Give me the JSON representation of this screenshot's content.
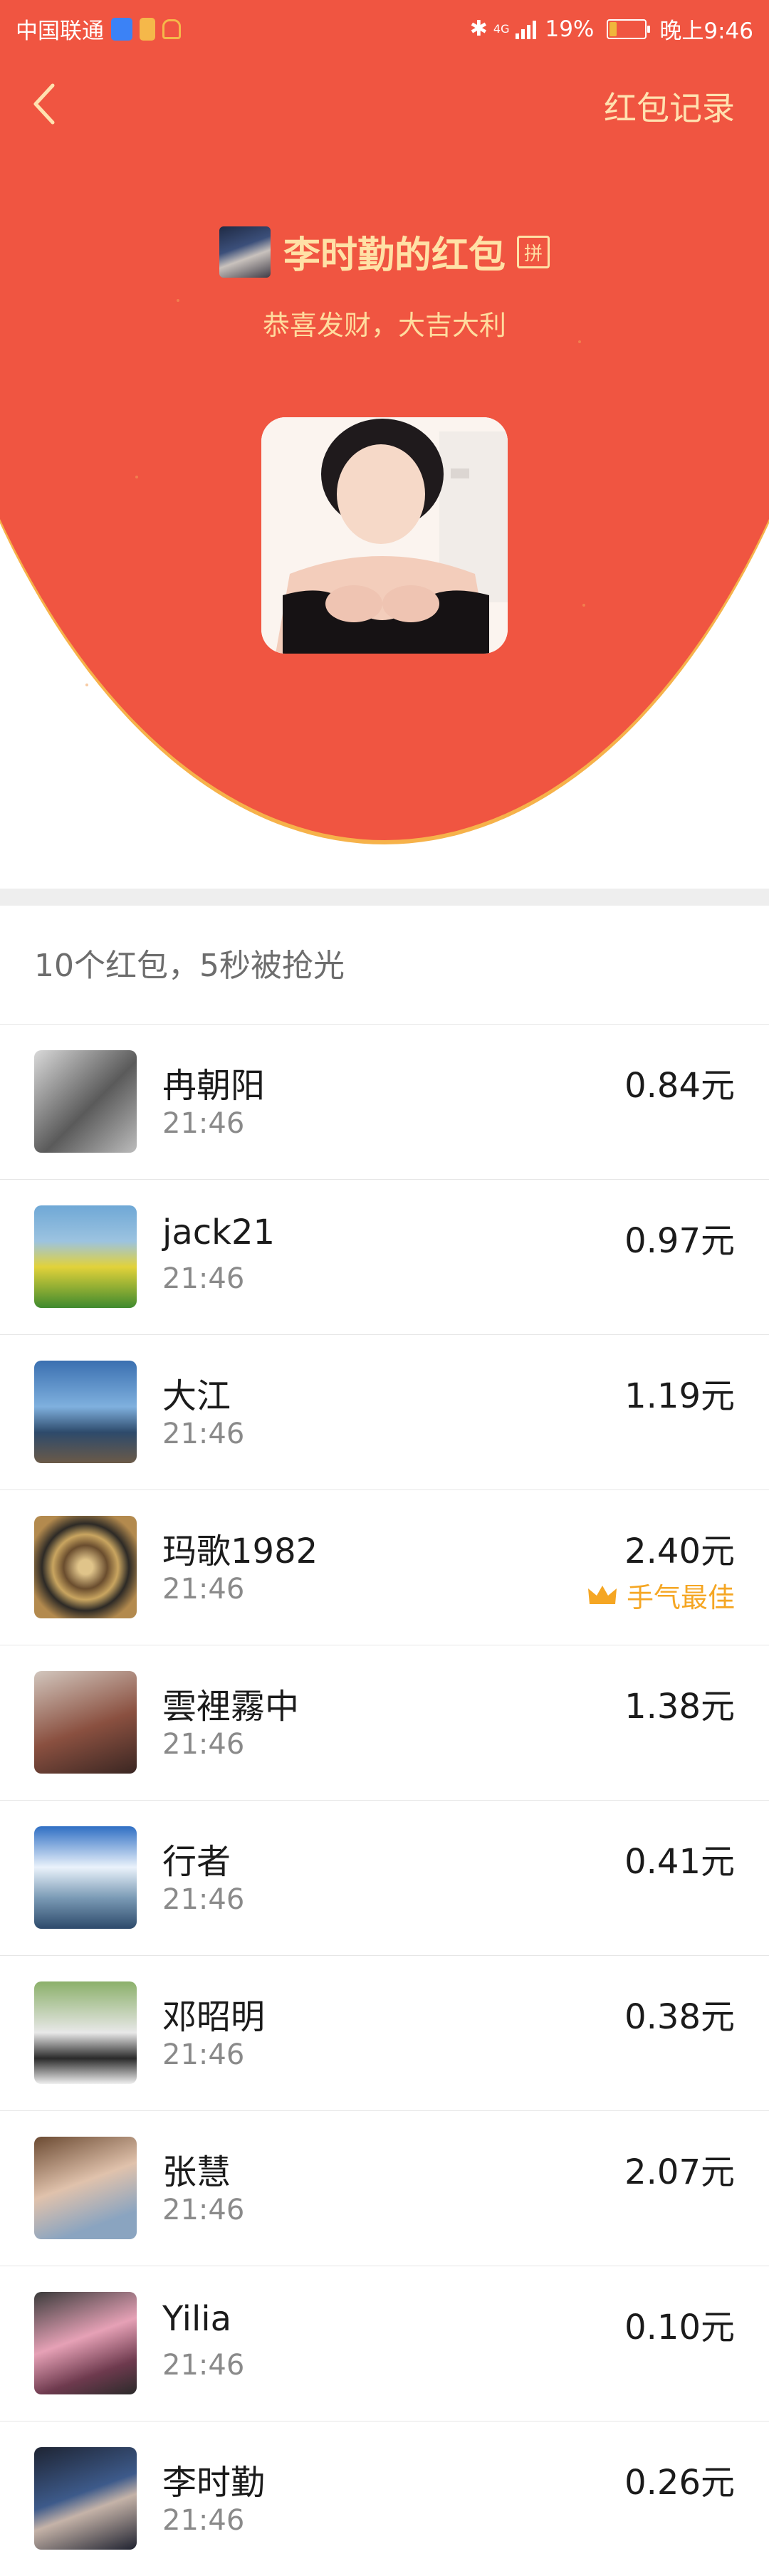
{
  "status_bar": {
    "carrier": "中国联通",
    "network": "4G",
    "battery_percent": "19%",
    "battery_level": 0.19,
    "clock": "晚上9:46"
  },
  "nav": {
    "back_icon": "chevron-left-icon",
    "records_label": "红包记录"
  },
  "sender": {
    "name": "李时勤的红包",
    "badge": "拼",
    "wish": "恭喜发财，大吉大利"
  },
  "summary": "10个红包，5秒被抢光",
  "best_label": "手气最佳",
  "colors": {
    "header_red": "#f05541",
    "gold_text": "#ffe1a6",
    "best_orange": "#f5a623"
  },
  "items": [
    {
      "name": "冉朝阳",
      "time": "21:46",
      "amount": "0.84元",
      "best": false
    },
    {
      "name": "jack21",
      "time": "21:46",
      "amount": "0.97元",
      "best": false
    },
    {
      "name": "大江",
      "time": "21:46",
      "amount": "1.19元",
      "best": false
    },
    {
      "name": "玛歌1982",
      "time": "21:46",
      "amount": "2.40元",
      "best": true
    },
    {
      "name": "雲裡霧中",
      "time": "21:46",
      "amount": "1.38元",
      "best": false
    },
    {
      "name": "行者",
      "time": "21:46",
      "amount": "0.41元",
      "best": false
    },
    {
      "name": "邓昭明",
      "time": "21:46",
      "amount": "0.38元",
      "best": false
    },
    {
      "name": "张慧",
      "time": "21:46",
      "amount": "2.07元",
      "best": false
    },
    {
      "name": "Yilia",
      "time": "21:46",
      "amount": "0.10元",
      "best": false
    },
    {
      "name": "李时勤",
      "time": "21:46",
      "amount": "0.26元",
      "best": false
    }
  ]
}
